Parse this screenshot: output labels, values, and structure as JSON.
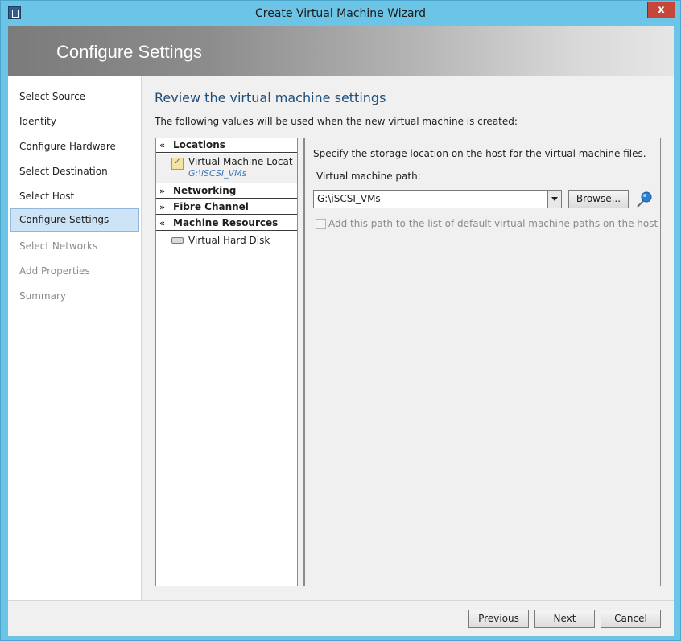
{
  "window": {
    "title": "Create Virtual Machine Wizard",
    "close_label": "x"
  },
  "banner": {
    "heading": "Configure Settings"
  },
  "nav": {
    "items": [
      {
        "label": "Select Source",
        "state": "normal"
      },
      {
        "label": "Identity",
        "state": "normal"
      },
      {
        "label": "Configure Hardware",
        "state": "normal"
      },
      {
        "label": "Select Destination",
        "state": "normal"
      },
      {
        "label": "Select Host",
        "state": "normal"
      },
      {
        "label": "Configure Settings",
        "state": "active"
      },
      {
        "label": "Select Networks",
        "state": "disabled"
      },
      {
        "label": "Add Properties",
        "state": "disabled"
      },
      {
        "label": "Summary",
        "state": "disabled"
      }
    ]
  },
  "main": {
    "title": "Review the virtual machine settings",
    "description": "The following values will be used when the new virtual machine is created:"
  },
  "tree": {
    "locations": {
      "label": "Locations",
      "chevron": "«"
    },
    "vm_location": {
      "label": "Virtual Machine Locati...",
      "value": "G:\\iSCSI_VMs"
    },
    "networking": {
      "label": "Networking",
      "chevron": "»"
    },
    "fibre_channel": {
      "label": "Fibre Channel",
      "chevron": "»"
    },
    "machine_resources": {
      "label": "Machine Resources",
      "chevron": "«"
    },
    "virtual_hard_disk": {
      "label": "Virtual Hard Disk"
    }
  },
  "details": {
    "description": "Specify the storage location on the host for the virtual machine files.",
    "path_label": "Virtual machine path:",
    "path_value": "G:\\iSCSI_VMs",
    "browse_label": "Browse...",
    "checkbox_label": "Add this path to the list of default virtual machine paths on the host",
    "checkbox_checked": false
  },
  "footer": {
    "previous_label": "Previous",
    "next_label": "Next",
    "cancel_label": "Cancel"
  },
  "colors": {
    "titlebar": "#6cc4e6",
    "active_nav": "#cde4f7",
    "heading_blue": "#1f4e79",
    "close_red": "#c7463a"
  }
}
